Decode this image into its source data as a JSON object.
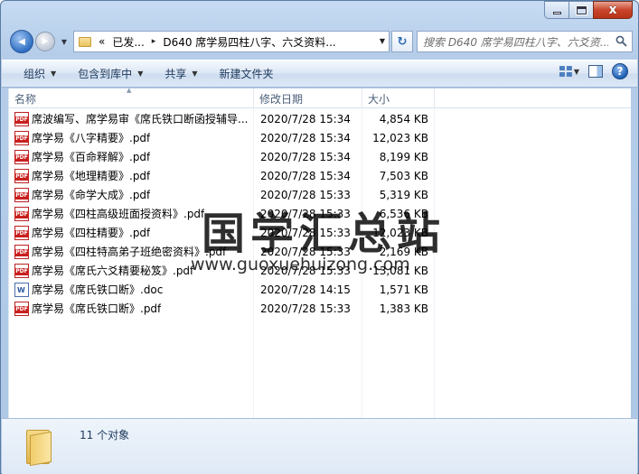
{
  "window": {
    "close_glyph": "x"
  },
  "nav": {
    "back_glyph": "◀",
    "forward_glyph": "▶",
    "breadcrumb": [
      "«",
      "已发...",
      "▸",
      "D640 席学易四柱八字、六爻资料..."
    ],
    "search_placeholder": "搜索 D640 席学易四柱八字、六爻资...",
    "refresh_glyph": "↻"
  },
  "toolbar": {
    "organize": "组织",
    "include_library": "包含到库中",
    "share": "共享",
    "new_folder": "新建文件夹",
    "help": "?"
  },
  "columns": {
    "name": "名称",
    "date": "修改日期",
    "size": "大小"
  },
  "files": [
    {
      "name": "席波编写、席学易审《席氏铁口断函授辅导...",
      "date": "2020/7/28 15:34",
      "size": "4,854 KB",
      "type": "pdf"
    },
    {
      "name": "席学易《八字精要》.pdf",
      "date": "2020/7/28 15:34",
      "size": "12,023 KB",
      "type": "pdf"
    },
    {
      "name": "席学易《百命释解》.pdf",
      "date": "2020/7/28 15:34",
      "size": "8,199 KB",
      "type": "pdf"
    },
    {
      "name": "席学易《地理精要》.pdf",
      "date": "2020/7/28 15:34",
      "size": "7,503 KB",
      "type": "pdf"
    },
    {
      "name": "席学易《命学大成》.pdf",
      "date": "2020/7/28 15:33",
      "size": "5,319 KB",
      "type": "pdf"
    },
    {
      "name": "席学易《四柱高级班面授资料》.pdf",
      "date": "2020/7/28 15:33",
      "size": "6,536 KB",
      "type": "pdf"
    },
    {
      "name": "席学易《四柱精要》.pdf",
      "date": "2020/7/28 15:33",
      "size": "12,023 KB",
      "type": "pdf"
    },
    {
      "name": "席学易《四柱特高弟子班绝密资料》.pdf",
      "date": "2020/7/28 15:33",
      "size": "2,169 KB",
      "type": "pdf"
    },
    {
      "name": "席学易《席氏六爻精要秘笈》.pdf",
      "date": "2020/7/28 15:33",
      "size": "13,081 KB",
      "type": "pdf"
    },
    {
      "name": "席学易《席氏铁口断》.doc",
      "date": "2020/7/28 14:15",
      "size": "1,571 KB",
      "type": "doc"
    },
    {
      "name": "席学易《席氏铁口断》.pdf",
      "date": "2020/7/28 15:33",
      "size": "1,383 KB",
      "type": "pdf"
    }
  ],
  "status": {
    "count": "11 个对象"
  },
  "watermark": {
    "title": "国学汇总站",
    "url": "www.guoxuehuizong.com"
  }
}
